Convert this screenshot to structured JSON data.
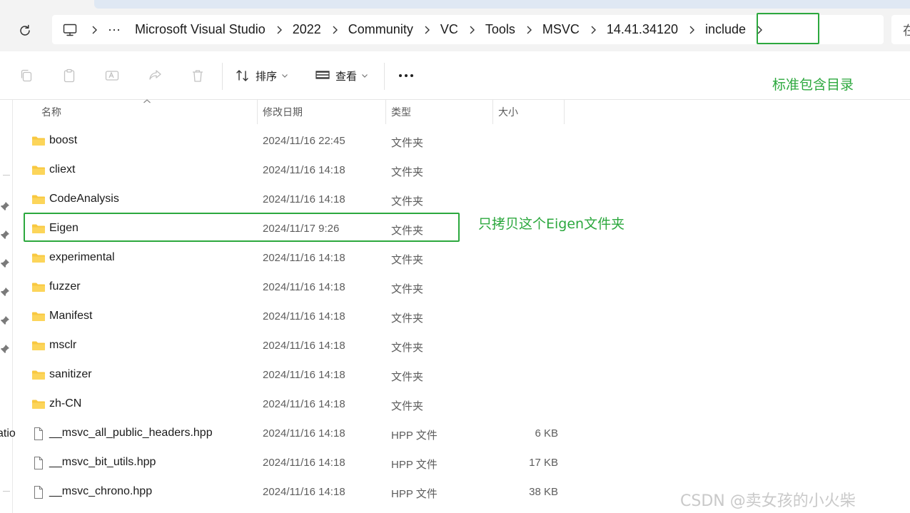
{
  "address_bar": {
    "more_label": "···",
    "crumbs": [
      "Microsoft Visual Studio",
      "2022",
      "Community",
      "VC",
      "Tools",
      "MSVC",
      "14.41.34120",
      "include"
    ],
    "search_partial": "在"
  },
  "toolbar": {
    "sort_label": "排序",
    "view_label": "查看",
    "more_label": "···"
  },
  "annotations": {
    "include_note": "标准包含目录",
    "eigen_note": "只拷贝这个Eigen文件夹"
  },
  "nav_pane": {
    "partial_text": "atio"
  },
  "columns": {
    "name": "名称",
    "modified": "修改日期",
    "type": "类型",
    "size": "大小"
  },
  "files": [
    {
      "name": "boost",
      "modified": "2024/11/16 22:45",
      "type": "文件夹",
      "size": "",
      "kind": "folder"
    },
    {
      "name": "cliext",
      "modified": "2024/11/16 14:18",
      "type": "文件夹",
      "size": "",
      "kind": "folder"
    },
    {
      "name": "CodeAnalysis",
      "modified": "2024/11/16 14:18",
      "type": "文件夹",
      "size": "",
      "kind": "folder"
    },
    {
      "name": "Eigen",
      "modified": "2024/11/17 9:26",
      "type": "文件夹",
      "size": "",
      "kind": "folder"
    },
    {
      "name": "experimental",
      "modified": "2024/11/16 14:18",
      "type": "文件夹",
      "size": "",
      "kind": "folder"
    },
    {
      "name": "fuzzer",
      "modified": "2024/11/16 14:18",
      "type": "文件夹",
      "size": "",
      "kind": "folder"
    },
    {
      "name": "Manifest",
      "modified": "2024/11/16 14:18",
      "type": "文件夹",
      "size": "",
      "kind": "folder"
    },
    {
      "name": "msclr",
      "modified": "2024/11/16 14:18",
      "type": "文件夹",
      "size": "",
      "kind": "folder"
    },
    {
      "name": "sanitizer",
      "modified": "2024/11/16 14:18",
      "type": "文件夹",
      "size": "",
      "kind": "folder"
    },
    {
      "name": "zh-CN",
      "modified": "2024/11/16 14:18",
      "type": "文件夹",
      "size": "",
      "kind": "folder"
    },
    {
      "name": "__msvc_all_public_headers.hpp",
      "modified": "2024/11/16 14:18",
      "type": "HPP 文件",
      "size": "6 KB",
      "kind": "file"
    },
    {
      "name": "__msvc_bit_utils.hpp",
      "modified": "2024/11/16 14:18",
      "type": "HPP 文件",
      "size": "17 KB",
      "kind": "file"
    },
    {
      "name": "__msvc_chrono.hpp",
      "modified": "2024/11/16 14:18",
      "type": "HPP 文件",
      "size": "38 KB",
      "kind": "file"
    }
  ],
  "watermark": "CSDN @卖女孩的小火柴",
  "colors": {
    "annotation": "#2ca83e",
    "folder": "#f8c840"
  }
}
